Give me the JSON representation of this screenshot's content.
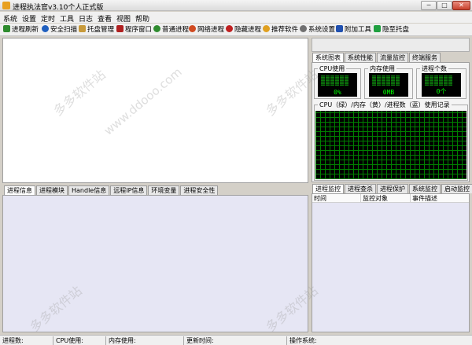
{
  "window": {
    "title": "进程执法官v3.10个人正式版",
    "min_symbol": "─",
    "max_symbol": "□",
    "close_symbol": "✕"
  },
  "menu": [
    "系统",
    "设置",
    "定时",
    "工具",
    "日志",
    "查看",
    "视图",
    "帮助"
  ],
  "toolbar": [
    {
      "label": "进程刷新",
      "icon": "refresh-icon",
      "color": "#2e8b2e"
    },
    {
      "label": "安全扫描",
      "icon": "scan-icon",
      "color": "#1f5fbf"
    },
    {
      "label": "托盘管理",
      "icon": "tray-icon",
      "color": "#c89a3a"
    },
    {
      "label": "程序窗口",
      "icon": "window-icon",
      "color": "#b02020"
    },
    {
      "label": "普通进程",
      "icon": "process-icon",
      "color": "#2e8b2e"
    },
    {
      "label": "网络进程",
      "icon": "network-icon",
      "color": "#d04a20"
    },
    {
      "label": "隐藏进程",
      "icon": "hidden-process-icon",
      "color": "#c02020"
    },
    {
      "label": "推荐软件",
      "icon": "recommend-icon",
      "color": "#e0a020"
    },
    {
      "label": "系统设置",
      "icon": "settings-icon",
      "color": "#707070"
    },
    {
      "label": "附加工具",
      "icon": "tools-icon",
      "color": "#2050b0"
    },
    {
      "label": "隐至托盘",
      "icon": "hide-to-tray-icon",
      "color": "#20a040"
    }
  ],
  "monitor_tabs": [
    "系统图表",
    "系统性能",
    "流量监控",
    "终端服务"
  ],
  "meters": [
    {
      "label": "CPU使用",
      "value": "0%"
    },
    {
      "label": "内存使用",
      "value": "0MB"
    },
    {
      "label": "进程个数",
      "value": "0个"
    }
  ],
  "history_label": "CPU（绿）/内存（黄）/进程数（蓝）使用记录",
  "bottom_tabs": [
    "进程信息",
    "进程模块",
    "Handle信息",
    "远程IP信息",
    "环境变量",
    "进程安全性"
  ],
  "right_tabs": [
    "进程监控",
    "进程查杀",
    "进程保护",
    "系统监控",
    "启动监控"
  ],
  "columns": [
    "时间",
    "监控对象",
    "事件描述"
  ],
  "statusbar": [
    "进程数:",
    "CPU使用:",
    "内存使用:",
    "更新时间:",
    "操作系统:"
  ],
  "watermark": "多多软件站",
  "watermark_url": "www.ddooo.com"
}
